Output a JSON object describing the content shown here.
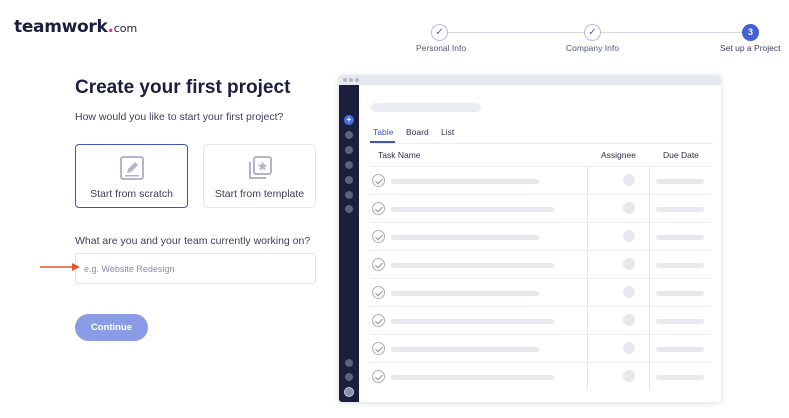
{
  "logo": {
    "name": "teamwork",
    "dot": ".",
    "tld": "com"
  },
  "stepper": {
    "steps": [
      {
        "label": "Personal Info",
        "marker": "✓",
        "state": "completed"
      },
      {
        "label": "Company Info",
        "marker": "✓",
        "state": "completed"
      },
      {
        "label": "Set up a Project",
        "marker": "3",
        "state": "active"
      }
    ]
  },
  "main": {
    "title": "Create your first project",
    "subtitle": "How would you like to start your first project?",
    "options": [
      {
        "label": "Start from scratch",
        "icon": "edit-document-icon",
        "selected": true
      },
      {
        "label": "Start from template",
        "icon": "template-star-icon",
        "selected": false
      }
    ],
    "question": "What are you and your team currently working on?",
    "input": {
      "placeholder": "e.g. Website Redesign",
      "value": ""
    },
    "continue_label": "Continue"
  },
  "preview": {
    "tabs": [
      "Table",
      "Board",
      "List"
    ],
    "active_tab": "Table",
    "columns": [
      "Task Name",
      "Assignee",
      "Due Date"
    ],
    "row_count": 8
  },
  "colors": {
    "accent": "#4461d7",
    "button": "#8a9ce6",
    "sidebar": "#1b1e3d",
    "logo_dot": "#ff22b1",
    "arrow": "#e0582a"
  }
}
